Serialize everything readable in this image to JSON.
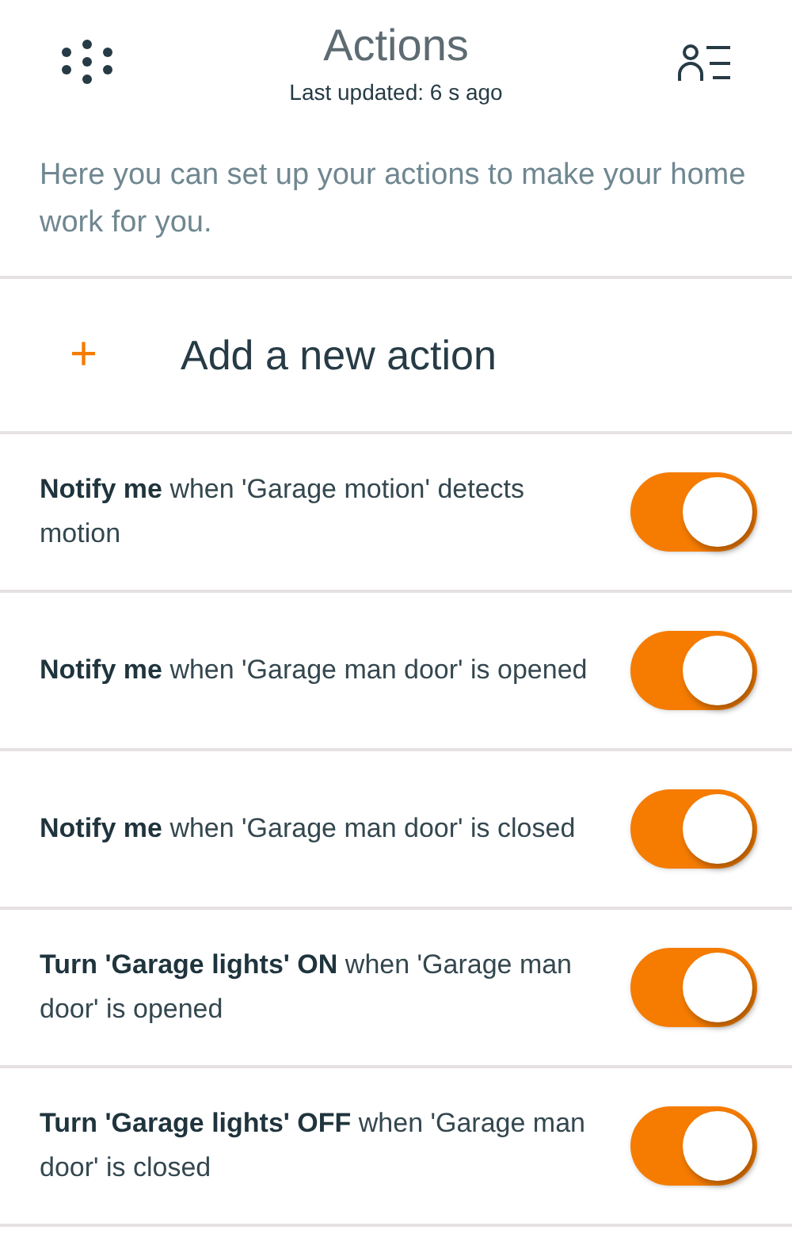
{
  "header": {
    "title": "Actions",
    "subtitle": "Last updated: 6 s ago"
  },
  "intro": "Here you can set up your actions to make your home work for you.",
  "add_action": {
    "icon": "+",
    "label": "Add a new action"
  },
  "actions": [
    {
      "text": "**Notify me** when 'Garage motion' detects motion",
      "on": true
    },
    {
      "text": "**Notify me** when 'Garage man door' is opened",
      "on": true
    },
    {
      "text": "**Notify me** when 'Garage man door' is closed",
      "on": true
    },
    {
      "text": "**Turn 'Garage lights' ON** when 'Garage man door' is opened",
      "on": true
    },
    {
      "text": "**Turn 'Garage lights' OFF** when 'Garage man door' is closed",
      "on": true
    }
  ]
}
